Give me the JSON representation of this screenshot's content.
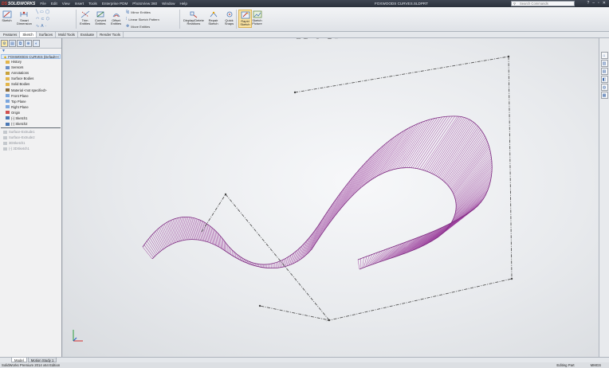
{
  "app": {
    "logo_text": "SOLIDWORKS",
    "document_title": "FOXWOODS CURVES.SLDPRT",
    "menu": [
      "File",
      "Edit",
      "View",
      "Insert",
      "Tools",
      "Enterprise PDM",
      "PhotoView 360",
      "Window",
      "Help"
    ],
    "search_placeholder": "Search Commands"
  },
  "ribbon": {
    "sketch": "Sketch",
    "smart_dimension_1": "Smart",
    "smart_dimension_2": "Dimension",
    "trim_1": "Trim",
    "trim_2": "Entities",
    "convert_1": "Convert",
    "convert_2": "Entities",
    "offset_1": "Offset",
    "offset_2": "Entities",
    "mirror": "Mirror Entities",
    "linear_pattern": "Linear Sketch Pattern",
    "move": "Move Entities",
    "display_delete_1": "Display/Delete",
    "display_delete_2": "Relations",
    "repair_1": "Repair",
    "repair_2": "Sketch",
    "quick_snaps_1": "Quick",
    "quick_snaps_2": "Snaps",
    "rapid_sketch_1": "Rapid",
    "rapid_sketch_2": "Sketch",
    "sketch_picture_1": "Sketch",
    "sketch_picture_2": "Picture"
  },
  "command_tabs": [
    "Features",
    "Sketch",
    "Surfaces",
    "Mold Tools",
    "Evaluate",
    "Render Tools"
  ],
  "active_tab": "Sketch",
  "feature_tree": {
    "root": "FOXWOODS CURVES (Default<<",
    "items": [
      {
        "label": "History",
        "icon": "folder-icon",
        "dim": false
      },
      {
        "label": "Sensors",
        "icon": "sensor-icon",
        "dim": false
      },
      {
        "label": "Annotations",
        "icon": "annotation-icon",
        "dim": false
      },
      {
        "label": "Surface Bodies",
        "icon": "folder-icon",
        "dim": false
      },
      {
        "label": "Solid Bodies",
        "icon": "folder-icon",
        "dim": false
      },
      {
        "label": "Material <not specified>",
        "icon": "material-icon",
        "dim": false
      },
      {
        "label": "Front Plane",
        "icon": "plane-icon",
        "dim": false
      },
      {
        "label": "Top Plane",
        "icon": "plane-icon",
        "dim": false
      },
      {
        "label": "Right Plane",
        "icon": "plane-icon",
        "dim": false
      },
      {
        "label": "Origin",
        "icon": "origin-icon",
        "dim": false
      },
      {
        "label": "(-) Sketch1",
        "icon": "sketch-icon",
        "dim": false
      },
      {
        "label": "(-) Sketch2",
        "icon": "sketch-icon",
        "dim": false
      }
    ],
    "rolled_back": [
      {
        "label": "Surface-Extrude1",
        "icon": "surface-icon"
      },
      {
        "label": "Surface-Extrude2",
        "icon": "surface-icon"
      },
      {
        "label": "3DSketch1",
        "icon": "sketch-icon"
      },
      {
        "label": "(-) 3DSketch1",
        "icon": "sketch-icon"
      }
    ]
  },
  "bottom_tabs": [
    "Model",
    "Motion Study 1"
  ],
  "status": {
    "left": "SolidWorks Premium 2014 x64 Edition",
    "mode": "Editing Part",
    "units": "MMGS"
  },
  "colors": {
    "surface": "#9b3f9c",
    "sketch_line": "#555555",
    "accent": "#3f78c5"
  }
}
